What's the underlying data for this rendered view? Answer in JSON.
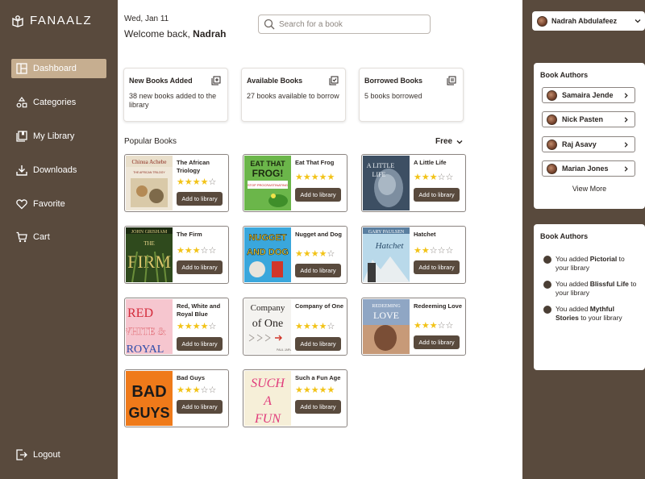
{
  "brand": {
    "name": "FANAALZ"
  },
  "nav": {
    "items": [
      {
        "label": "Dashboard",
        "icon": "dashboard-icon"
      },
      {
        "label": "Categories",
        "icon": "categories-icon"
      },
      {
        "label": "My Library",
        "icon": "library-icon"
      },
      {
        "label": "Downloads",
        "icon": "download-icon"
      },
      {
        "label": "Favorite",
        "icon": "heart-icon"
      },
      {
        "label": "Cart",
        "icon": "cart-icon"
      }
    ],
    "logout": "Logout"
  },
  "header": {
    "date": "Wed, Jan 11",
    "welcome_prefix": "Welcome back, ",
    "user_name": "Nadrah"
  },
  "search": {
    "placeholder": "Search for a book"
  },
  "stats": [
    {
      "title": "New Books Added",
      "count": "38",
      "text": " new books added to the library"
    },
    {
      "title": "Available Books",
      "count": "",
      "text": "27 books available to borrow"
    },
    {
      "title": "Borrowed Books",
      "count": "",
      "text": "5 books borrowed"
    }
  ],
  "popular": {
    "title": "Popular Books",
    "filter": "Free",
    "add_label": "Add to library",
    "books": [
      {
        "title": "The African Triology",
        "rating": 4,
        "cover_text": "Chinua Achebe"
      },
      {
        "title": "Eat That Frog",
        "rating": 5,
        "cover_text": "EAT THAT FROG!"
      },
      {
        "title": "A Little Life",
        "rating": 3,
        "cover_text": "A LITTLE LIFE"
      },
      {
        "title": "The Firm",
        "rating": 3,
        "cover_text": "THE FIRM"
      },
      {
        "title": "Nugget and Dog",
        "rating": 4,
        "cover_text": "NUGGET AND DOG"
      },
      {
        "title": "Hatchet",
        "rating": 2,
        "cover_text": "Hatchet"
      },
      {
        "title": "Red, White and Royal Blue",
        "rating": 4,
        "cover_text": "RED, WHITE & ROYAL"
      },
      {
        "title": "Company of One",
        "rating": 4,
        "cover_text": "Company of One"
      },
      {
        "title": "Redeeming Love",
        "rating": 3,
        "cover_text": "REDEEMING LOVE"
      },
      {
        "title": "Bad Guys",
        "rating": 3,
        "cover_text": "BAD GUYS"
      },
      {
        "title": "Such a Fun Age",
        "rating": 5,
        "cover_text": "SUCH A FUN"
      }
    ]
  },
  "user": {
    "name": "Nadrah Abdulafeez"
  },
  "authors_panel": {
    "title": "Book Authors",
    "authors": [
      "Samaira Jende",
      "Nick Pasten",
      "Raj Asavy",
      "Marian Jones"
    ],
    "view_more": "View More"
  },
  "activity_panel": {
    "title": "Book Authors",
    "items": [
      {
        "prefix": "You added ",
        "book": "Pictorial",
        "suffix": " to your library"
      },
      {
        "prefix": "You added ",
        "book": "Blissful Life",
        "suffix": " to your library"
      },
      {
        "prefix": "You added ",
        "book": "Mythful Stories",
        "suffix": " to your library"
      }
    ]
  },
  "colors": {
    "sidebar_bg": "#594a3d",
    "active_nav": "#c6ae90",
    "star": "#f2c318",
    "button": "#594a3d"
  }
}
